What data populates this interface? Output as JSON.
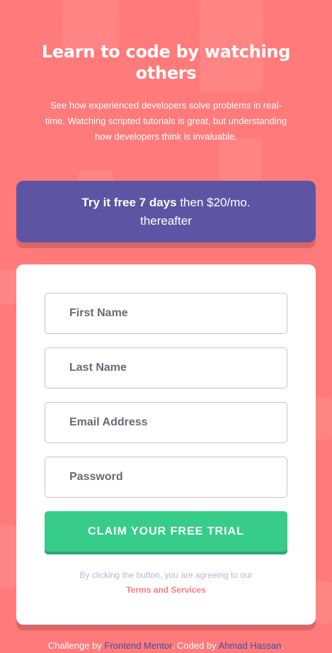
{
  "hero": {
    "title_line1": "Learn to code by watching",
    "title_line2": "others",
    "description_line1": "See how experienced developers solve problems in real-",
    "description_line2": "time. Watching scripted tutorials is great, but understanding",
    "description_line3": "how developers think is invaluable."
  },
  "promo": {
    "strong_text": "Try it free 7 days",
    "rest_text": " then $20/mo.",
    "line2": "thereafter"
  },
  "form": {
    "first_name_placeholder": "First Name",
    "last_name_placeholder": "Last Name",
    "email_placeholder": "Email Address",
    "password_placeholder": "Password",
    "submit_label": "CLAIM YOUR FREE TRIAL",
    "terms_prefix": "By clicking the button, you are agreeing to our",
    "terms_link": "Terms and Services"
  },
  "footer": {
    "challenge_by": "Challenge by ",
    "frontend_mentor": "Frontend Mentor",
    "coded_by": ". Coded by ",
    "author": "Ahmad Hassan",
    "end": "."
  },
  "colors": {
    "background": "#ff7a7a",
    "banner": "#5e54a4",
    "button": "#38cc8b",
    "accent_link": "#3e52a3"
  }
}
